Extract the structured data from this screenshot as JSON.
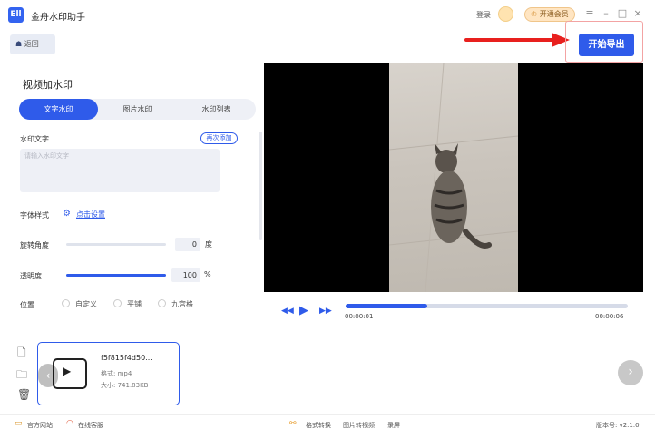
{
  "app": {
    "title": "金舟水印助手",
    "logo_text": "Ell"
  },
  "titlebar": {
    "login": "登录",
    "vip_label": "开通会员"
  },
  "toolbar": {
    "back_label": "返回",
    "export_label": "开始导出"
  },
  "panel": {
    "title": "视频加水印",
    "tabs": [
      {
        "label": "文字水印"
      },
      {
        "label": "图片水印"
      },
      {
        "label": "水印列表"
      }
    ],
    "watermark_text_label": "水印文字",
    "add_again_label": "再次添加",
    "watermark_text_placeholder": "请输入水印文字",
    "font_style_label": "字体样式",
    "font_style_link": "点击设置",
    "rotation_label": "旋转角度",
    "rotation_value": "0",
    "rotation_unit": "度",
    "opacity_label": "透明度",
    "opacity_value": "100",
    "opacity_unit": "%",
    "position_label": "位置",
    "position_options": [
      {
        "label": "自定义"
      },
      {
        "label": "平铺"
      },
      {
        "label": "九宫格"
      }
    ]
  },
  "player": {
    "current_time": "00:00:01",
    "duration": "00:00:06",
    "progress_fraction": 0.29
  },
  "file": {
    "name": "f5f815f4d50...",
    "format": "格式: mp4",
    "size": "大小: 741.83KB"
  },
  "footer": {
    "official_site": "官方网站",
    "online_support": "在线客服",
    "format_convert": "格式转换",
    "image_to_video": "图片转视频",
    "screen_record": "录屏",
    "version": "版本号: v2.1.0"
  },
  "colors": {
    "accent": "#2f5bea",
    "annotation_red": "#e8201e"
  }
}
